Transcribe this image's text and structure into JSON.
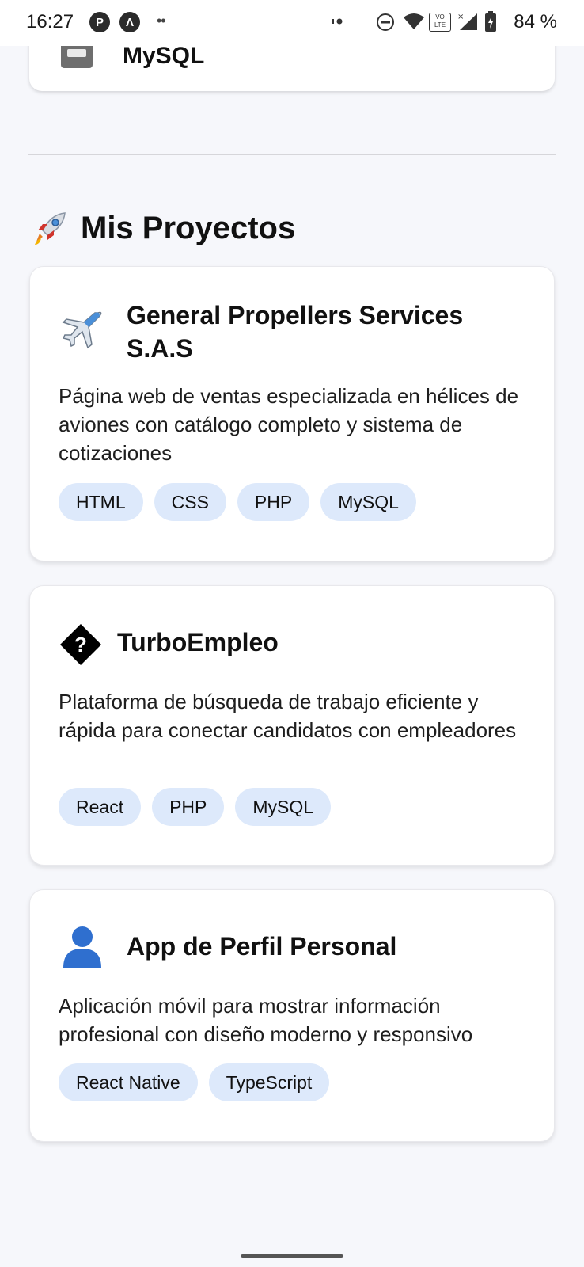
{
  "status_bar": {
    "time": "16:27",
    "left_icons": [
      "p-circle-icon",
      "a-circle-icon",
      "more-dots-icon"
    ],
    "right_icons": [
      "nfc-icon",
      "dnd-icon",
      "wifi-icon",
      "volte-icon",
      "signal-icon",
      "battery-icon"
    ],
    "volte_label": "VO LTE",
    "battery": "84 %"
  },
  "previous_card": {
    "label": "MySQL"
  },
  "section": {
    "title": "Mis Proyectos",
    "icon": "rocket-icon"
  },
  "projects": [
    {
      "icon": "airplane-icon",
      "title": "General Propellers Services S.A.S",
      "description": "Página web de ventas especializada en hélices de aviones con catálogo completo y sistema de cotizaciones",
      "tags": [
        "HTML",
        "CSS",
        "PHP",
        "MySQL"
      ]
    },
    {
      "icon": "question-diamond-icon",
      "title": "TurboEmpleo",
      "description": "Plataforma de búsqueda de trabajo eficiente y rápida para conectar candidatos con empleadores",
      "tags": [
        "React",
        "PHP",
        "MySQL"
      ]
    },
    {
      "icon": "person-icon",
      "title": "App de Perfil Personal",
      "description": "Aplicación móvil para mostrar información profesional con diseño moderno y responsivo",
      "tags": [
        "React Native",
        "TypeScript"
      ]
    }
  ],
  "colors": {
    "background": "#f6f7fb",
    "card": "#ffffff",
    "tag_background": "#dde9fb",
    "person_icon": "#2f6fcf"
  }
}
